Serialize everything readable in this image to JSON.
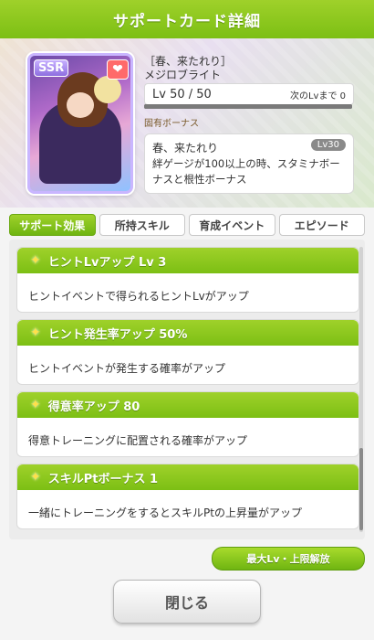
{
  "dialog": {
    "title": "サポートカード詳細",
    "close_label": "閉じる"
  },
  "card": {
    "rarity": "SSR",
    "favorite_icon": "heart-icon",
    "title": "［春、来たれり］",
    "name": "メジロブライト",
    "level_text": "Lv 50 / 50",
    "next_level_text": "次のLvまで 0",
    "level_progress": 1.0
  },
  "unique_bonus": {
    "section_label": "固有ボーナス",
    "name": "春、来たれり",
    "level_badge": "Lv30",
    "description": "絆ゲージが100以上の時、スタミナボーナスと根性ボーナス"
  },
  "tabs": [
    {
      "label": "サポート効果",
      "active": true
    },
    {
      "label": "所持スキル",
      "active": false
    },
    {
      "label": "育成イベント",
      "active": false
    },
    {
      "label": "エピソード",
      "active": false
    }
  ],
  "effects": [
    {
      "label": "ヒントLvアップ Lv 3",
      "description": "ヒントイベントで得られるヒントLvがアップ"
    },
    {
      "label": "ヒント発生率アップ 50%",
      "description": "ヒントイベントが発生する確率がアップ"
    },
    {
      "label": "得意率アップ 80",
      "description": "得意トレーニングに配置される確率がアップ"
    },
    {
      "label": "スキルPtボーナス 1",
      "description": "一緒にトレーニングをするとスキルPtの上昇量がアップ"
    }
  ],
  "limit_break_button": "最大Lv・上限解放",
  "colors": {
    "accent_green": "#7cbf14",
    "sparkle": "#ffe04a"
  }
}
